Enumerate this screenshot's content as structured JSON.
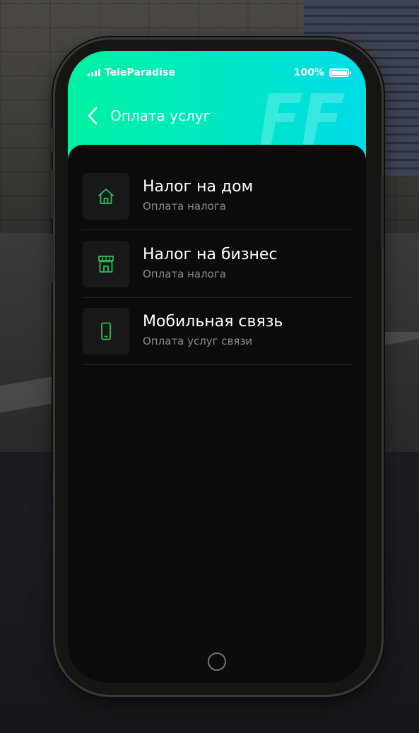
{
  "status_bar": {
    "carrier": "TeleParadise",
    "battery": "100%"
  },
  "header": {
    "title": "Оплата услуг",
    "accent_start": "#00f2a2",
    "accent_end": "#00dce8"
  },
  "services": [
    {
      "title": "Налог на дом",
      "subtitle": "Оплата налога",
      "icon": "house-icon"
    },
    {
      "title": "Налог на бизнес",
      "subtitle": "Оплата налога",
      "icon": "store-icon"
    },
    {
      "title": "Мобильная связь",
      "subtitle": "Оплата услуг связи",
      "icon": "smartphone-icon"
    }
  ],
  "colors": {
    "icon_green": "#2fbe5a",
    "background": "#0b0b0b",
    "tile": "#181818"
  }
}
